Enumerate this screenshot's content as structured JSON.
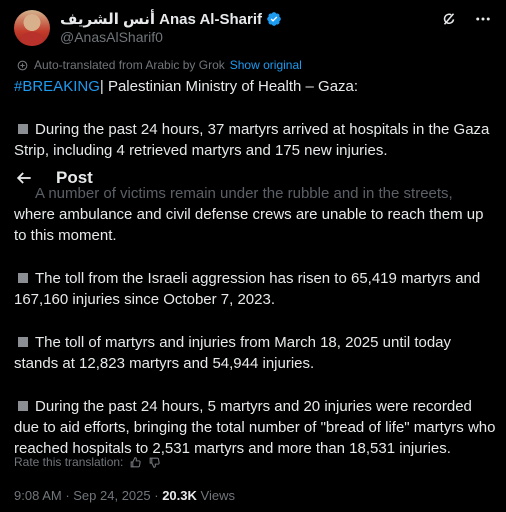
{
  "author": {
    "display_name": "أنس الشريف Anas Al-Sharif",
    "handle": "@AnasAlSharif0"
  },
  "translation": {
    "note": "Auto-translated from Arabic by Grok",
    "show_original": "Show original"
  },
  "post_header": {
    "title": "Post"
  },
  "tweet": {
    "hashtag": "#BREAKING",
    "headline_rest": "| Palestinian Ministry of Health – Gaza:",
    "p1": "During the past 24 hours, 37 martyrs arrived at hospitals in the Gaza Strip, including 4 retrieved martyrs and 175 new injuries.",
    "p2_faded": "A number of victims remain under the rubble and in the streets,",
    "p2_rest": " where ambulance and civil defense crews are unable to reach them up to this moment.",
    "p3": "The toll from the Israeli aggression has risen to 65,419 martyrs and 167,160 injuries since October 7, 2023.",
    "p4": "The toll of martyrs and injuries from March 18, 2025 until today stands at 12,823 martyrs and 54,944 injuries.",
    "p5": "During the past 24 hours, 5 martyrs and 20 injuries were recorded due to aid efforts, bringing the total number of \"bread of life\" martyrs who reached hospitals to 2,531 martyrs and more than 18,531 injuries."
  },
  "rating": {
    "label": "Rate this translation:"
  },
  "meta": {
    "time": "9:08 AM",
    "separator": " · ",
    "date": "Sep 24, 2025",
    "views_count": "20.3K",
    "views_label": "Views"
  },
  "icons": {
    "verified": "verified-badge-icon",
    "grok": "grok-icon",
    "more": "more-icon",
    "translate": "translate-icon",
    "back": "back-arrow-icon",
    "thumb_up": "thumbs-up-icon",
    "thumb_down": "thumbs-down-icon"
  },
  "colors": {
    "accent": "#1d9bf0",
    "text": "#e7e9ea",
    "muted": "#71767b",
    "background": "#000000"
  }
}
